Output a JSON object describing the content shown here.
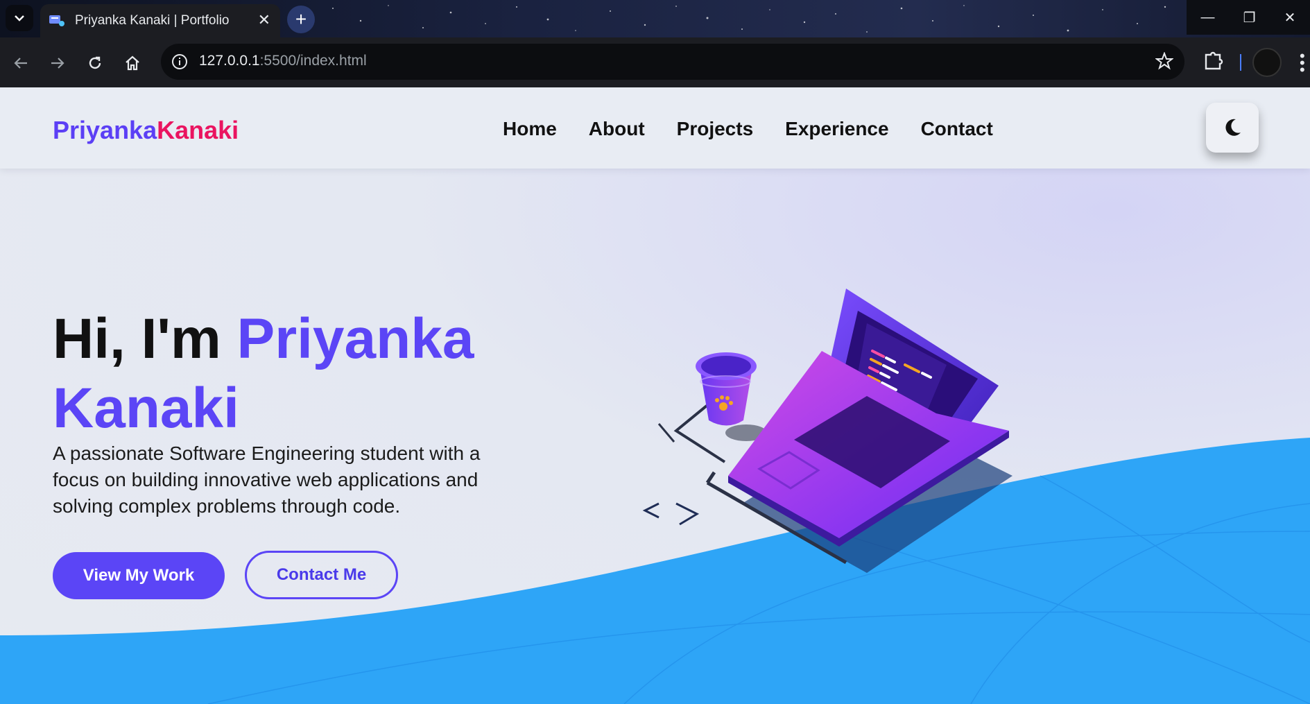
{
  "browser": {
    "tab_title": "Priyanka Kanaki | Portfolio",
    "url_host": "127.0.0.1",
    "url_path": ":5500/index.html"
  },
  "site": {
    "logo_first": "Priyanka",
    "logo_last": "Kanaki",
    "nav": [
      "Home",
      "About",
      "Projects",
      "Experience",
      "Contact"
    ],
    "theme_toggle_icon": "moon-icon"
  },
  "hero": {
    "greeting": "Hi, I'm ",
    "name": "Priyanka Kanaki",
    "description": "A passionate Software Engineering student with a focus on building innovative web applications and solving complex problems through code.",
    "primary_button": "View My Work",
    "secondary_button": "Contact Me"
  },
  "colors": {
    "accent": "#5b45f6",
    "logo_last": "#ea1460",
    "wave": "#2ea5f7"
  }
}
